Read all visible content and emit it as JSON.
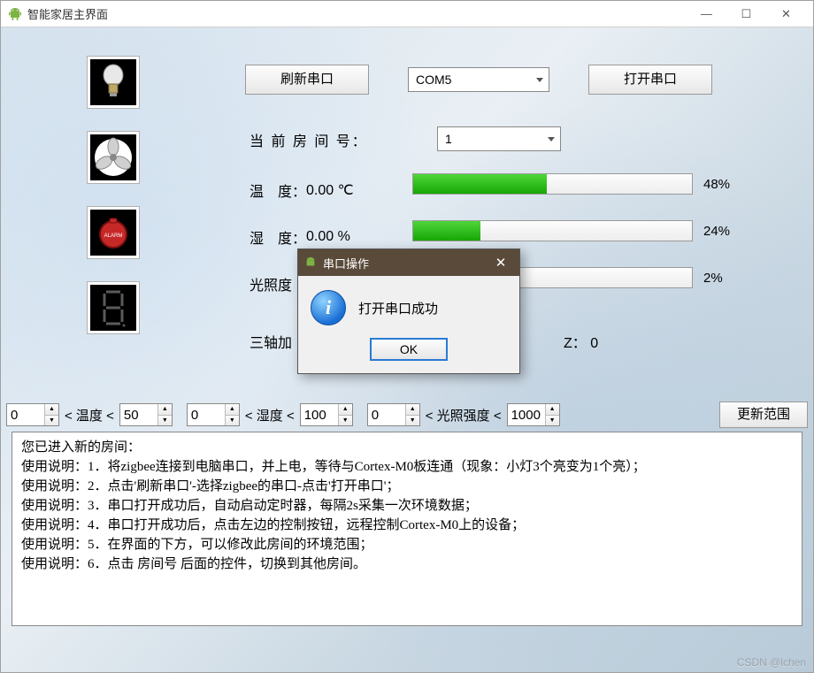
{
  "window": {
    "title": "智能家居主界面",
    "minimize": "—",
    "maximize": "☐",
    "close": "✕"
  },
  "devices": [
    {
      "name": "light-bulb-icon"
    },
    {
      "name": "fan-icon"
    },
    {
      "name": "alarm-icon"
    },
    {
      "name": "seven-segment-icon"
    }
  ],
  "toolbar": {
    "refresh_port_label": "刷新串口",
    "port_value": "COM5",
    "open_port_label": "打开串口"
  },
  "room": {
    "label": "当 前 房 间 号：",
    "value": "1"
  },
  "sensors": {
    "temp_label": "温 度：",
    "temp_value": "0.00 ℃",
    "temp_pct": 48,
    "temp_pct_text": "48%",
    "humid_label": "湿 度：",
    "humid_value": "0.00 %",
    "humid_pct": 24,
    "humid_pct_text": "24%",
    "light_prefix": "光照度",
    "light_pct": 2,
    "light_pct_text": "2%",
    "axis_prefix": "三轴加",
    "axis_z_label": "Z：",
    "axis_z_value": "0"
  },
  "range": {
    "temp_min": "0",
    "temp_label": "< 温度 <",
    "temp_max": "50",
    "humid_min": "0",
    "humid_label": "< 湿度 <",
    "humid_max": "100",
    "light_min": "0",
    "light_label": "< 光照强度 <",
    "light_max": "1000",
    "update_label": "更新范围"
  },
  "info_lines": [
    "您已进入新的房间：",
    "使用说明：1．将zigbee连接到电脑串口，并上电，等待与Cortex-M0板连通（现象：小灯3个亮变为1个亮）；",
    "使用说明：2．点击'刷新串口'-选择zigbee的串口-点击'打开串口'；",
    "使用说明：3．串口打开成功后，自动启动定时器，每隔2s采集一次环境数据；",
    "使用说明：4．串口打开成功后，点击左边的控制按钮，远程控制Cortex-M0上的设备；",
    "使用说明：5．在界面的下方，可以修改此房间的环境范围；",
    "使用说明：6．点击 房间号 后面的控件，切换到其他房间。"
  ],
  "dialog": {
    "title": "串口操作",
    "message": "打开串口成功",
    "ok_label": "OK",
    "close": "✕"
  },
  "watermark": "CSDN @lchen"
}
